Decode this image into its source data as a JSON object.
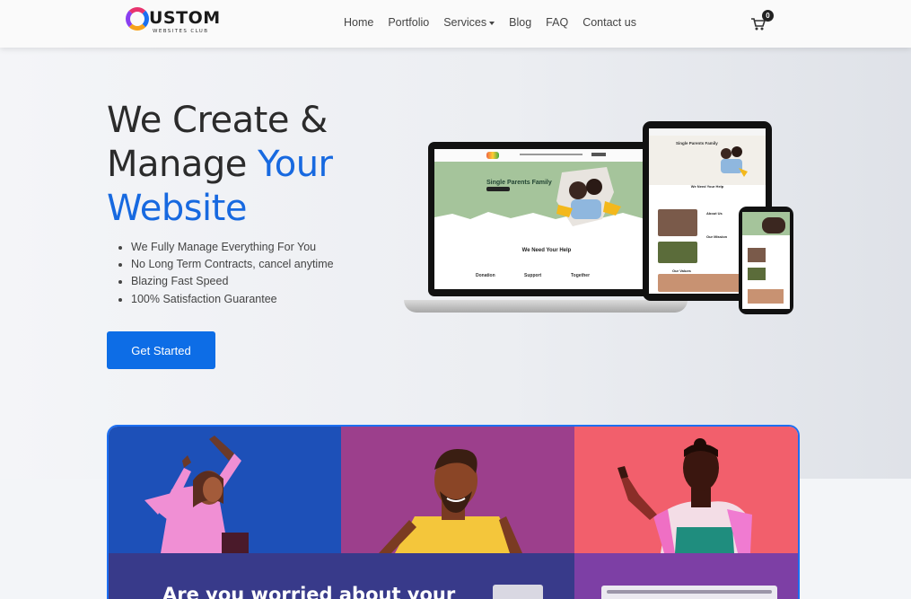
{
  "nav": {
    "logo_main": "USTOM",
    "logo_sub": "WEBSITES CLUB",
    "items": [
      {
        "label": "Home"
      },
      {
        "label": "Portfolio"
      },
      {
        "label": "Services"
      },
      {
        "label": "Blog"
      },
      {
        "label": "FAQ"
      },
      {
        "label": "Contact us"
      }
    ],
    "cart_count": "0"
  },
  "hero": {
    "line1": "We Create &",
    "line2a": "Manage ",
    "line2b": "Your",
    "line3": "Website",
    "bullets": [
      "We Fully Manage Everything For You",
      "No Long Term Contracts, cancel anytime",
      "Blazing Fast Speed",
      "100% Satisfaction Guarantee"
    ],
    "cta": "Get Started"
  },
  "mockup": {
    "laptop_title": "Single Parents Family",
    "laptop_heading": "We Need Your Help",
    "laptop_cols": [
      "Donation",
      "Support",
      "Together"
    ],
    "tablet_title": "Single Parents Family",
    "tablet_heading": "We Need Your Help",
    "tablet_about": "About Us",
    "tablet_mission": "Our Mission",
    "tablet_values": "Our Values"
  },
  "lower": {
    "headline": "Are you worried about your"
  },
  "colors": {
    "accent_blue": "#1769e0",
    "button_blue": "#0d6de6",
    "panel_blue": "#1d50b8",
    "panel_purple": "#9c3f8c",
    "panel_coral": "#f25f6c"
  }
}
